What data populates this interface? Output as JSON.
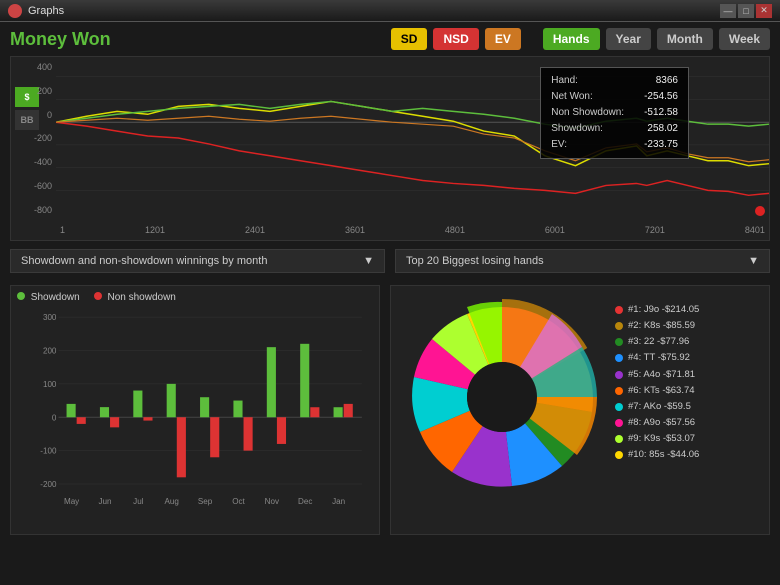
{
  "titleBar": {
    "icon": "graph-icon",
    "title": "Graphs",
    "minimize": "—",
    "maximize": "□",
    "close": "✕"
  },
  "header": {
    "moneyWonLabel": "Money Won",
    "filterButtons": [
      "SD",
      "NSD",
      "EV"
    ],
    "timeButtons": [
      "Hands",
      "Year",
      "Month",
      "Week"
    ]
  },
  "mainChart": {
    "yAxisLabels": [
      "400",
      "200",
      "0",
      "-200",
      "-400",
      "-600",
      "-800"
    ],
    "xAxisLabels": [
      "1",
      "1201",
      "2401",
      "3601",
      "4801",
      "6001",
      "7201",
      "8401"
    ],
    "sideButtons": [
      "$",
      "BB"
    ],
    "tooltip": {
      "hand_label": "Hand:",
      "hand_val": "8366",
      "net_label": "Net Won:",
      "net_val": "-254.56",
      "nonshowdown_label": "Non Showdown:",
      "nonshowdown_val": "-512.58",
      "showdown_label": "Showdown:",
      "showdown_val": "258.02",
      "ev_label": "EV:",
      "ev_val": "-233.75"
    }
  },
  "dropdowns": {
    "left": "Showdown and non-showdown winnings by month",
    "right": "Top 20 Biggest losing hands"
  },
  "barChart": {
    "legend": [
      {
        "label": "Showdown",
        "color": "#5dbe3c"
      },
      {
        "label": "Non showdown",
        "color": "#dd3333"
      }
    ],
    "yLabels": [
      "300",
      "200",
      "100",
      "0",
      "-100",
      "-200"
    ],
    "xLabels": [
      "May",
      "Jun",
      "Jul",
      "Aug",
      "Sep",
      "Oct",
      "Nov",
      "Dec",
      "Jan"
    ],
    "bars": [
      {
        "month": "May",
        "showdown": 40,
        "nonShowdown": -20
      },
      {
        "month": "Jun",
        "showdown": 30,
        "nonShowdown": -30
      },
      {
        "month": "Jul",
        "showdown": 80,
        "nonShowdown": -10
      },
      {
        "month": "Aug",
        "showdown": 100,
        "nonShowdown": -180
      },
      {
        "month": "Sep",
        "showdown": 60,
        "nonShowdown": -120
      },
      {
        "month": "Oct",
        "showdown": 50,
        "nonShowdown": -100
      },
      {
        "month": "Nov",
        "showdown": 210,
        "nonShowdown": -80
      },
      {
        "month": "Dec",
        "showdown": 220,
        "nonShowdown": 30
      },
      {
        "month": "Jan",
        "showdown": 30,
        "nonShowdown": 40
      }
    ]
  },
  "pieChart": {
    "legend": [
      {
        "rank": "#1:",
        "hand": "J9o",
        "value": "-$214.05",
        "color": "#e63333"
      },
      {
        "rank": "#2:",
        "hand": "K8s",
        "value": "-$85.59",
        "color": "#b8860b"
      },
      {
        "rank": "#3:",
        "hand": "22",
        "value": "-$77.96",
        "color": "#228B22"
      },
      {
        "rank": "#4:",
        "hand": "TT",
        "value": "-$75.92",
        "color": "#1e90ff"
      },
      {
        "rank": "#5:",
        "hand": "A4o",
        "value": "-$71.81",
        "color": "#9932cc"
      },
      {
        "rank": "#6:",
        "hand": "KTs",
        "value": "-$63.74",
        "color": "#ff6600"
      },
      {
        "rank": "#7:",
        "hand": "AKo",
        "value": "-$59.5",
        "color": "#00ced1"
      },
      {
        "rank": "#8:",
        "hand": "A9o",
        "value": "-$57.56",
        "color": "#ff1493"
      },
      {
        "rank": "#9:",
        "hand": "K9s",
        "value": "-$53.07",
        "color": "#adff2f"
      },
      {
        "rank": "#10:",
        "hand": "85s",
        "value": "-$44.06",
        "color": "#ffd700"
      }
    ]
  }
}
